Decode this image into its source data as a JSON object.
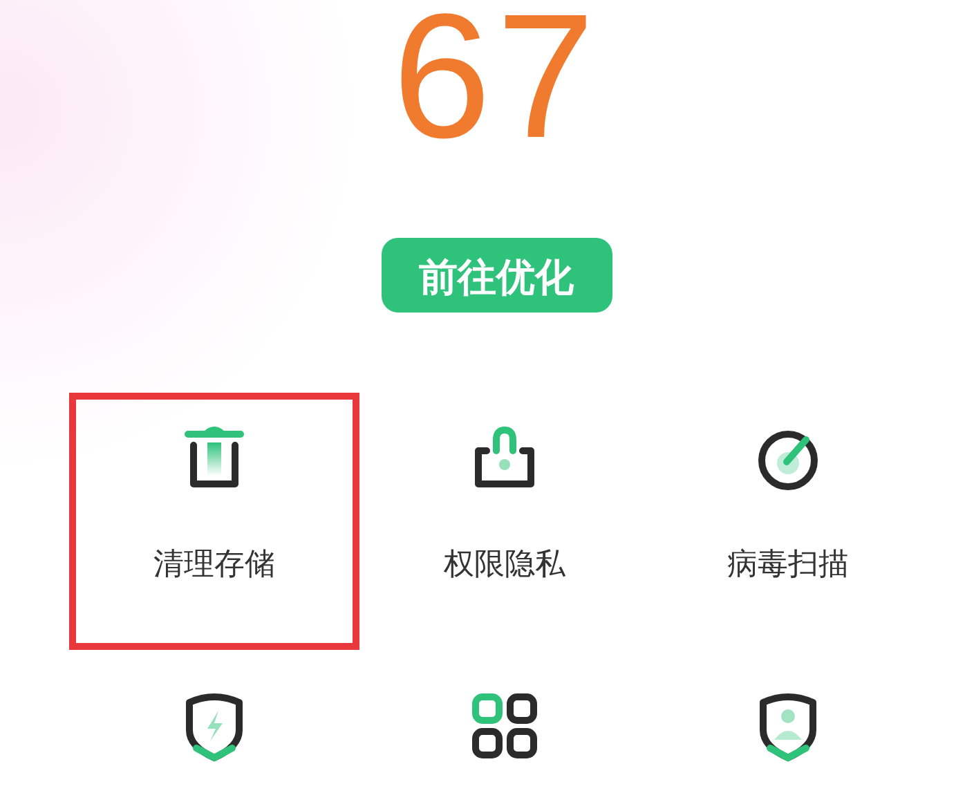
{
  "score": "67",
  "optimize_button": "前往优化",
  "tools": [
    {
      "kind": "trash",
      "label": "清理存储",
      "highlighted": true
    },
    {
      "kind": "lock",
      "label": "权限隐私",
      "highlighted": false
    },
    {
      "kind": "scan",
      "label": "病毒扫描",
      "highlighted": false
    },
    {
      "kind": "shield-bolt",
      "highlighted": false
    },
    {
      "kind": "apps",
      "highlighted": false
    },
    {
      "kind": "shield-person",
      "highlighted": false
    }
  ]
}
